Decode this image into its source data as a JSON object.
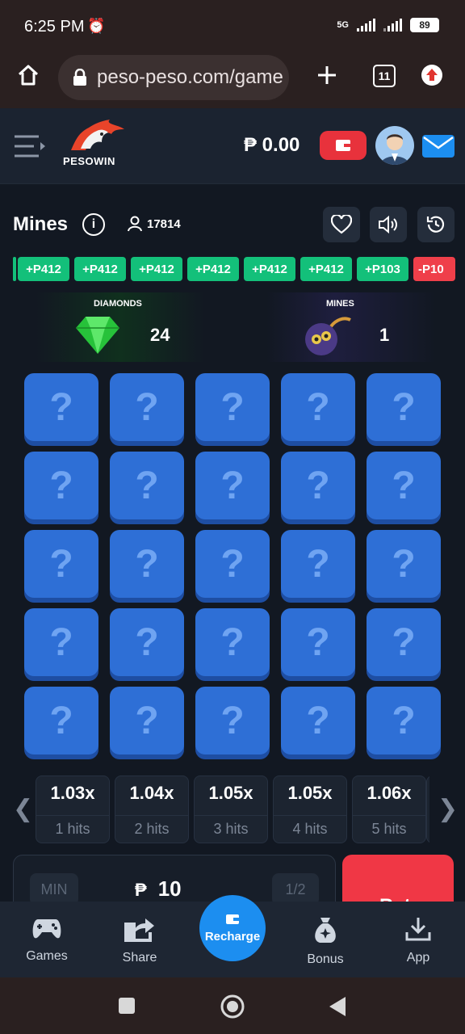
{
  "status_bar": {
    "time": "6:25 PM",
    "network": "5G",
    "battery": "89"
  },
  "browser": {
    "url": "peso-peso.com/game",
    "tab_count": "11"
  },
  "site": {
    "brand": "PESOWIN",
    "balance": "₱ 0.00"
  },
  "game": {
    "title": "Mines",
    "players": "17814",
    "ticker": [
      "+P412",
      "+P412",
      "+P412",
      "+P412",
      "+P412",
      "+P412",
      "+P103",
      "-P10"
    ],
    "diamonds_label": "DIAMONDS",
    "diamonds_count": "24",
    "mines_label": "MINES",
    "mines_count": "1",
    "tile_symbol": "?",
    "multipliers": [
      {
        "value": "1.03x",
        "hits": "1 hits"
      },
      {
        "value": "1.04x",
        "hits": "2 hits"
      },
      {
        "value": "1.05x",
        "hits": "3 hits"
      },
      {
        "value": "1.05x",
        "hits": "4 hits"
      },
      {
        "value": "1.06x",
        "hits": "5 hits"
      }
    ],
    "bet": {
      "min_label": "MIN",
      "currency": "₱",
      "amount": "10",
      "half_label": "1/2",
      "bet_label": "Bet"
    }
  },
  "bottom_nav": {
    "games": "Games",
    "share": "Share",
    "recharge": "Recharge",
    "bonus": "Bonus",
    "app": "App"
  },
  "colors": {
    "tile": "#2e6fd6",
    "positive_chip": "#13c07a",
    "negative_chip": "#ef3f4a",
    "accent_blue": "#1c8ef0",
    "bet_red": "#f03745"
  }
}
